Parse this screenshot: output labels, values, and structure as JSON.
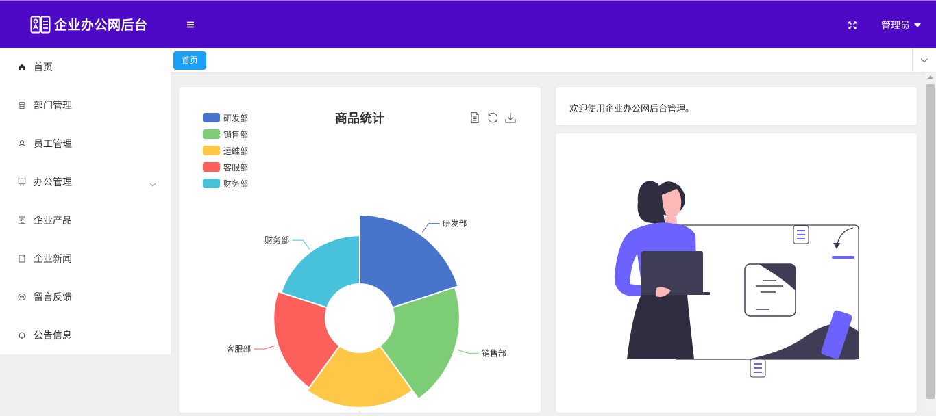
{
  "app": {
    "title": "企业办公网后台"
  },
  "header": {
    "user_label": "管理员"
  },
  "sidebar": {
    "items": [
      {
        "label": "首页",
        "icon": "home-icon"
      },
      {
        "label": "部门管理",
        "icon": "database-icon"
      },
      {
        "label": "员工管理",
        "icon": "user-icon"
      },
      {
        "label": "办公管理",
        "icon": "presentation-icon",
        "has_submenu": true
      },
      {
        "label": "企业产品",
        "icon": "product-icon"
      },
      {
        "label": "企业新闻",
        "icon": "news-icon"
      },
      {
        "label": "留言反馈",
        "icon": "message-icon"
      },
      {
        "label": "公告信息",
        "icon": "bell-icon"
      }
    ]
  },
  "tabs": [
    {
      "label": "首页",
      "active": true
    }
  ],
  "welcome": {
    "text": "欢迎使用企业办公网后台管理。"
  },
  "chart_data": {
    "type": "pie",
    "subtype": "nightingale-rose",
    "title": "商品统计",
    "series": [
      {
        "name": "研发部",
        "value": 40,
        "color": "#4874cb"
      },
      {
        "name": "销售部",
        "value": 38,
        "color": "#7ccd75"
      },
      {
        "name": "运维部",
        "value": 32,
        "color": "#fec746"
      },
      {
        "name": "客服部",
        "value": 30,
        "color": "#fd5f5a"
      },
      {
        "name": "财务部",
        "value": 28,
        "color": "#48c2db"
      }
    ],
    "legend": "top-left",
    "toolbox": [
      "data-view-icon",
      "refresh-icon",
      "download-icon"
    ]
  },
  "colors": {
    "header": "#4e09c6",
    "tab_active": "#1aa0f9",
    "illustration_accent": "#6c63ff"
  }
}
